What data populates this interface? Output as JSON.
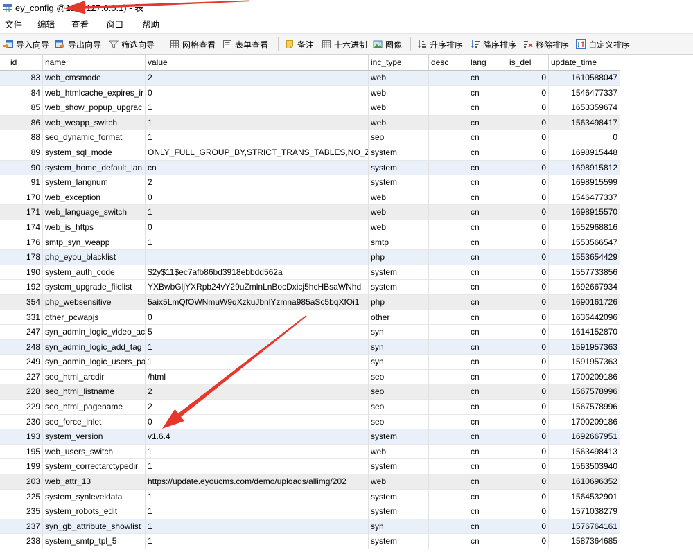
{
  "window": {
    "title": "ey_config @127 (127.0.0.1) - 表",
    "icon": "table-icon"
  },
  "menu": {
    "items": [
      "文件",
      "编辑",
      "查看",
      "窗口",
      "帮助"
    ]
  },
  "toolbar": {
    "items": [
      {
        "label": "导入向导",
        "icon": "import-wizard-icon"
      },
      {
        "label": "导出向导",
        "icon": "export-wizard-icon"
      },
      {
        "label": "筛选向导",
        "icon": "filter-wizard-icon"
      },
      {
        "label": "网格查看",
        "icon": "grid-view-icon"
      },
      {
        "label": "表单查看",
        "icon": "form-view-icon"
      },
      {
        "label": "备注",
        "icon": "memo-icon"
      },
      {
        "label": "十六进制",
        "icon": "hex-icon"
      },
      {
        "label": "图像",
        "icon": "image-icon"
      },
      {
        "label": "升序排序",
        "icon": "sort-ascending-icon"
      },
      {
        "label": "降序排序",
        "icon": "sort-descending-icon"
      },
      {
        "label": "移除排序",
        "icon": "remove-sort-icon"
      },
      {
        "label": "自定义排序",
        "icon": "custom-sort-icon"
      }
    ]
  },
  "table": {
    "columns": [
      "id",
      "name",
      "value",
      "inc_type",
      "desc",
      "lang",
      "is_del",
      "update_time"
    ],
    "rows": [
      [
        "83",
        "web_cmsmode",
        "2",
        "web",
        "",
        "cn",
        "0",
        "1610588047"
      ],
      [
        "84",
        "web_htmlcache_expires_ir",
        "0",
        "web",
        "",
        "cn",
        "0",
        "1546477337"
      ],
      [
        "85",
        "web_show_popup_upgrac",
        "1",
        "web",
        "",
        "cn",
        "0",
        "1653359674"
      ],
      [
        "86",
        "web_weapp_switch",
        "1",
        "web",
        "",
        "cn",
        "0",
        "1563498417"
      ],
      [
        "88",
        "seo_dynamic_format",
        "1",
        "seo",
        "",
        "cn",
        "0",
        "0"
      ],
      [
        "89",
        "system_sql_mode",
        "ONLY_FULL_GROUP_BY,STRICT_TRANS_TABLES,NO_ZER",
        "system",
        "",
        "cn",
        "0",
        "1698915448"
      ],
      [
        "90",
        "system_home_default_lan",
        "cn",
        "system",
        "",
        "cn",
        "0",
        "1698915812"
      ],
      [
        "91",
        "system_langnum",
        "2",
        "system",
        "",
        "cn",
        "0",
        "1698915599"
      ],
      [
        "170",
        "web_exception",
        "0",
        "web",
        "",
        "cn",
        "0",
        "1546477337"
      ],
      [
        "171",
        "web_language_switch",
        "1",
        "web",
        "",
        "cn",
        "0",
        "1698915570"
      ],
      [
        "174",
        "web_is_https",
        "0",
        "web",
        "",
        "cn",
        "0",
        "1552968816"
      ],
      [
        "176",
        "smtp_syn_weapp",
        "1",
        "smtp",
        "",
        "cn",
        "0",
        "1553566547"
      ],
      [
        "178",
        "php_eyou_blacklist",
        "",
        "php",
        "",
        "cn",
        "0",
        "1553654429"
      ],
      [
        "190",
        "system_auth_code",
        "$2y$11$ec7afb86bd3918ebbdd562a",
        "system",
        "",
        "cn",
        "0",
        "1557733856"
      ],
      [
        "192",
        "system_upgrade_filelist",
        "YXBwbGljYXRpb24vY29uZmlnLnBocDxicj5hcHBsaWNhd",
        "system",
        "",
        "cn",
        "0",
        "1692667934"
      ],
      [
        "354",
        "php_websensitive",
        "5aix5LmQfOWNmuW9qXzkuJbnlYzmna985aSc5bqXfOi1",
        "php",
        "",
        "cn",
        "0",
        "1690161726"
      ],
      [
        "331",
        "other_pcwapjs",
        "0",
        "other",
        "",
        "cn",
        "0",
        "1636442096"
      ],
      [
        "247",
        "syn_admin_logic_video_ac",
        "5",
        "syn",
        "",
        "cn",
        "0",
        "1614152870"
      ],
      [
        "248",
        "syn_admin_logic_add_tag",
        "1",
        "syn",
        "",
        "cn",
        "0",
        "1591957363"
      ],
      [
        "249",
        "syn_admin_logic_users_pa",
        "1",
        "syn",
        "",
        "cn",
        "0",
        "1591957363"
      ],
      [
        "227",
        "seo_html_arcdir",
        "/html",
        "seo",
        "",
        "cn",
        "0",
        "1700209186"
      ],
      [
        "228",
        "seo_html_listname",
        "2",
        "seo",
        "",
        "cn",
        "0",
        "1567578996"
      ],
      [
        "229",
        "seo_html_pagename",
        "2",
        "seo",
        "",
        "cn",
        "0",
        "1567578996"
      ],
      [
        "230",
        "seo_force_inlet",
        "0",
        "seo",
        "",
        "cn",
        "0",
        "1700209186"
      ],
      [
        "193",
        "system_version",
        "v1.6.4",
        "system",
        "",
        "cn",
        "0",
        "1692667951"
      ],
      [
        "195",
        "web_users_switch",
        "1",
        "web",
        "",
        "cn",
        "0",
        "1563498413"
      ],
      [
        "199",
        "system_correctarctypedir",
        "1",
        "system",
        "",
        "cn",
        "0",
        "1563503940"
      ],
      [
        "203",
        "web_attr_13",
        "https://update.eyoucms.com/demo/uploads/allimg/202",
        "web",
        "",
        "cn",
        "0",
        "1610696352"
      ],
      [
        "225",
        "system_synleveldata",
        "1",
        "system",
        "",
        "cn",
        "0",
        "1564532901"
      ],
      [
        "235",
        "system_robots_edit",
        "1",
        "system",
        "",
        "cn",
        "0",
        "1571038279"
      ],
      [
        "237",
        "syn_gb_attribute_showlist",
        "1",
        "syn",
        "",
        "cn",
        "0",
        "1576764161"
      ],
      [
        "238",
        "system_smtp_tpl_5",
        "1",
        "system",
        "",
        "cn",
        "0",
        "1587364685"
      ]
    ]
  },
  "colors": {
    "annotation_arrow": "#e5372b",
    "row_stripe_blue": "#e9f0fa",
    "row_stripe_gray": "#ededed",
    "icon_blue": "#3d74c2"
  }
}
